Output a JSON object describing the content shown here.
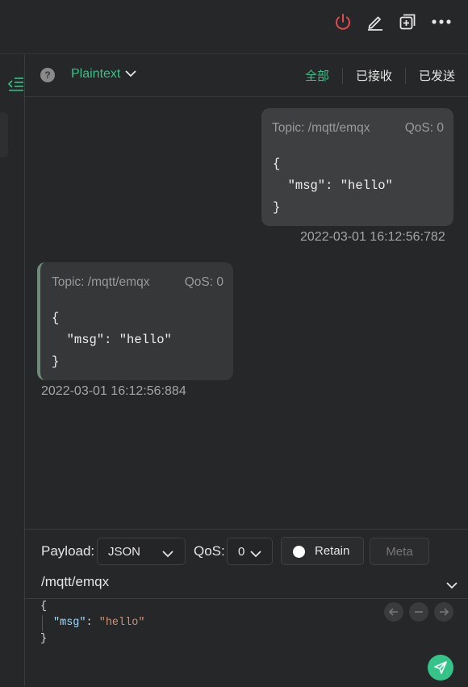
{
  "header": {
    "icons": [
      "power-icon",
      "edit-icon",
      "new-window-icon",
      "more-icon"
    ],
    "accent": "#34c388",
    "danger": "#e5484d"
  },
  "toolbar": {
    "help_glyph": "?",
    "format": "Plaintext",
    "filters": [
      "全部",
      "已接收",
      "已发送"
    ],
    "active_filter": "全部"
  },
  "messages": [
    {
      "direction": "sent",
      "topic": "Topic: /mqtt/emqx",
      "qos": "QoS: 0",
      "payload": "{\n  \"msg\": \"hello\"\n}",
      "timestamp": "2022-03-01 16:12:56:782"
    },
    {
      "direction": "received",
      "topic": "Topic: /mqtt/emqx",
      "qos": "QoS: 0",
      "payload": "{\n  \"msg\": \"hello\"\n}",
      "timestamp": "2022-03-01 16:12:56:884"
    }
  ],
  "composer": {
    "payload_label": "Payload:",
    "payload_type": "JSON",
    "qos_label": "QoS:",
    "qos_value": "0",
    "retain_label": "Retain",
    "meta_label": "Meta",
    "topic": "/mqtt/emqx",
    "editor": {
      "open": "{",
      "key": "\"msg\"",
      "colon": ": ",
      "value": "\"hello\"",
      "close": "}"
    }
  }
}
